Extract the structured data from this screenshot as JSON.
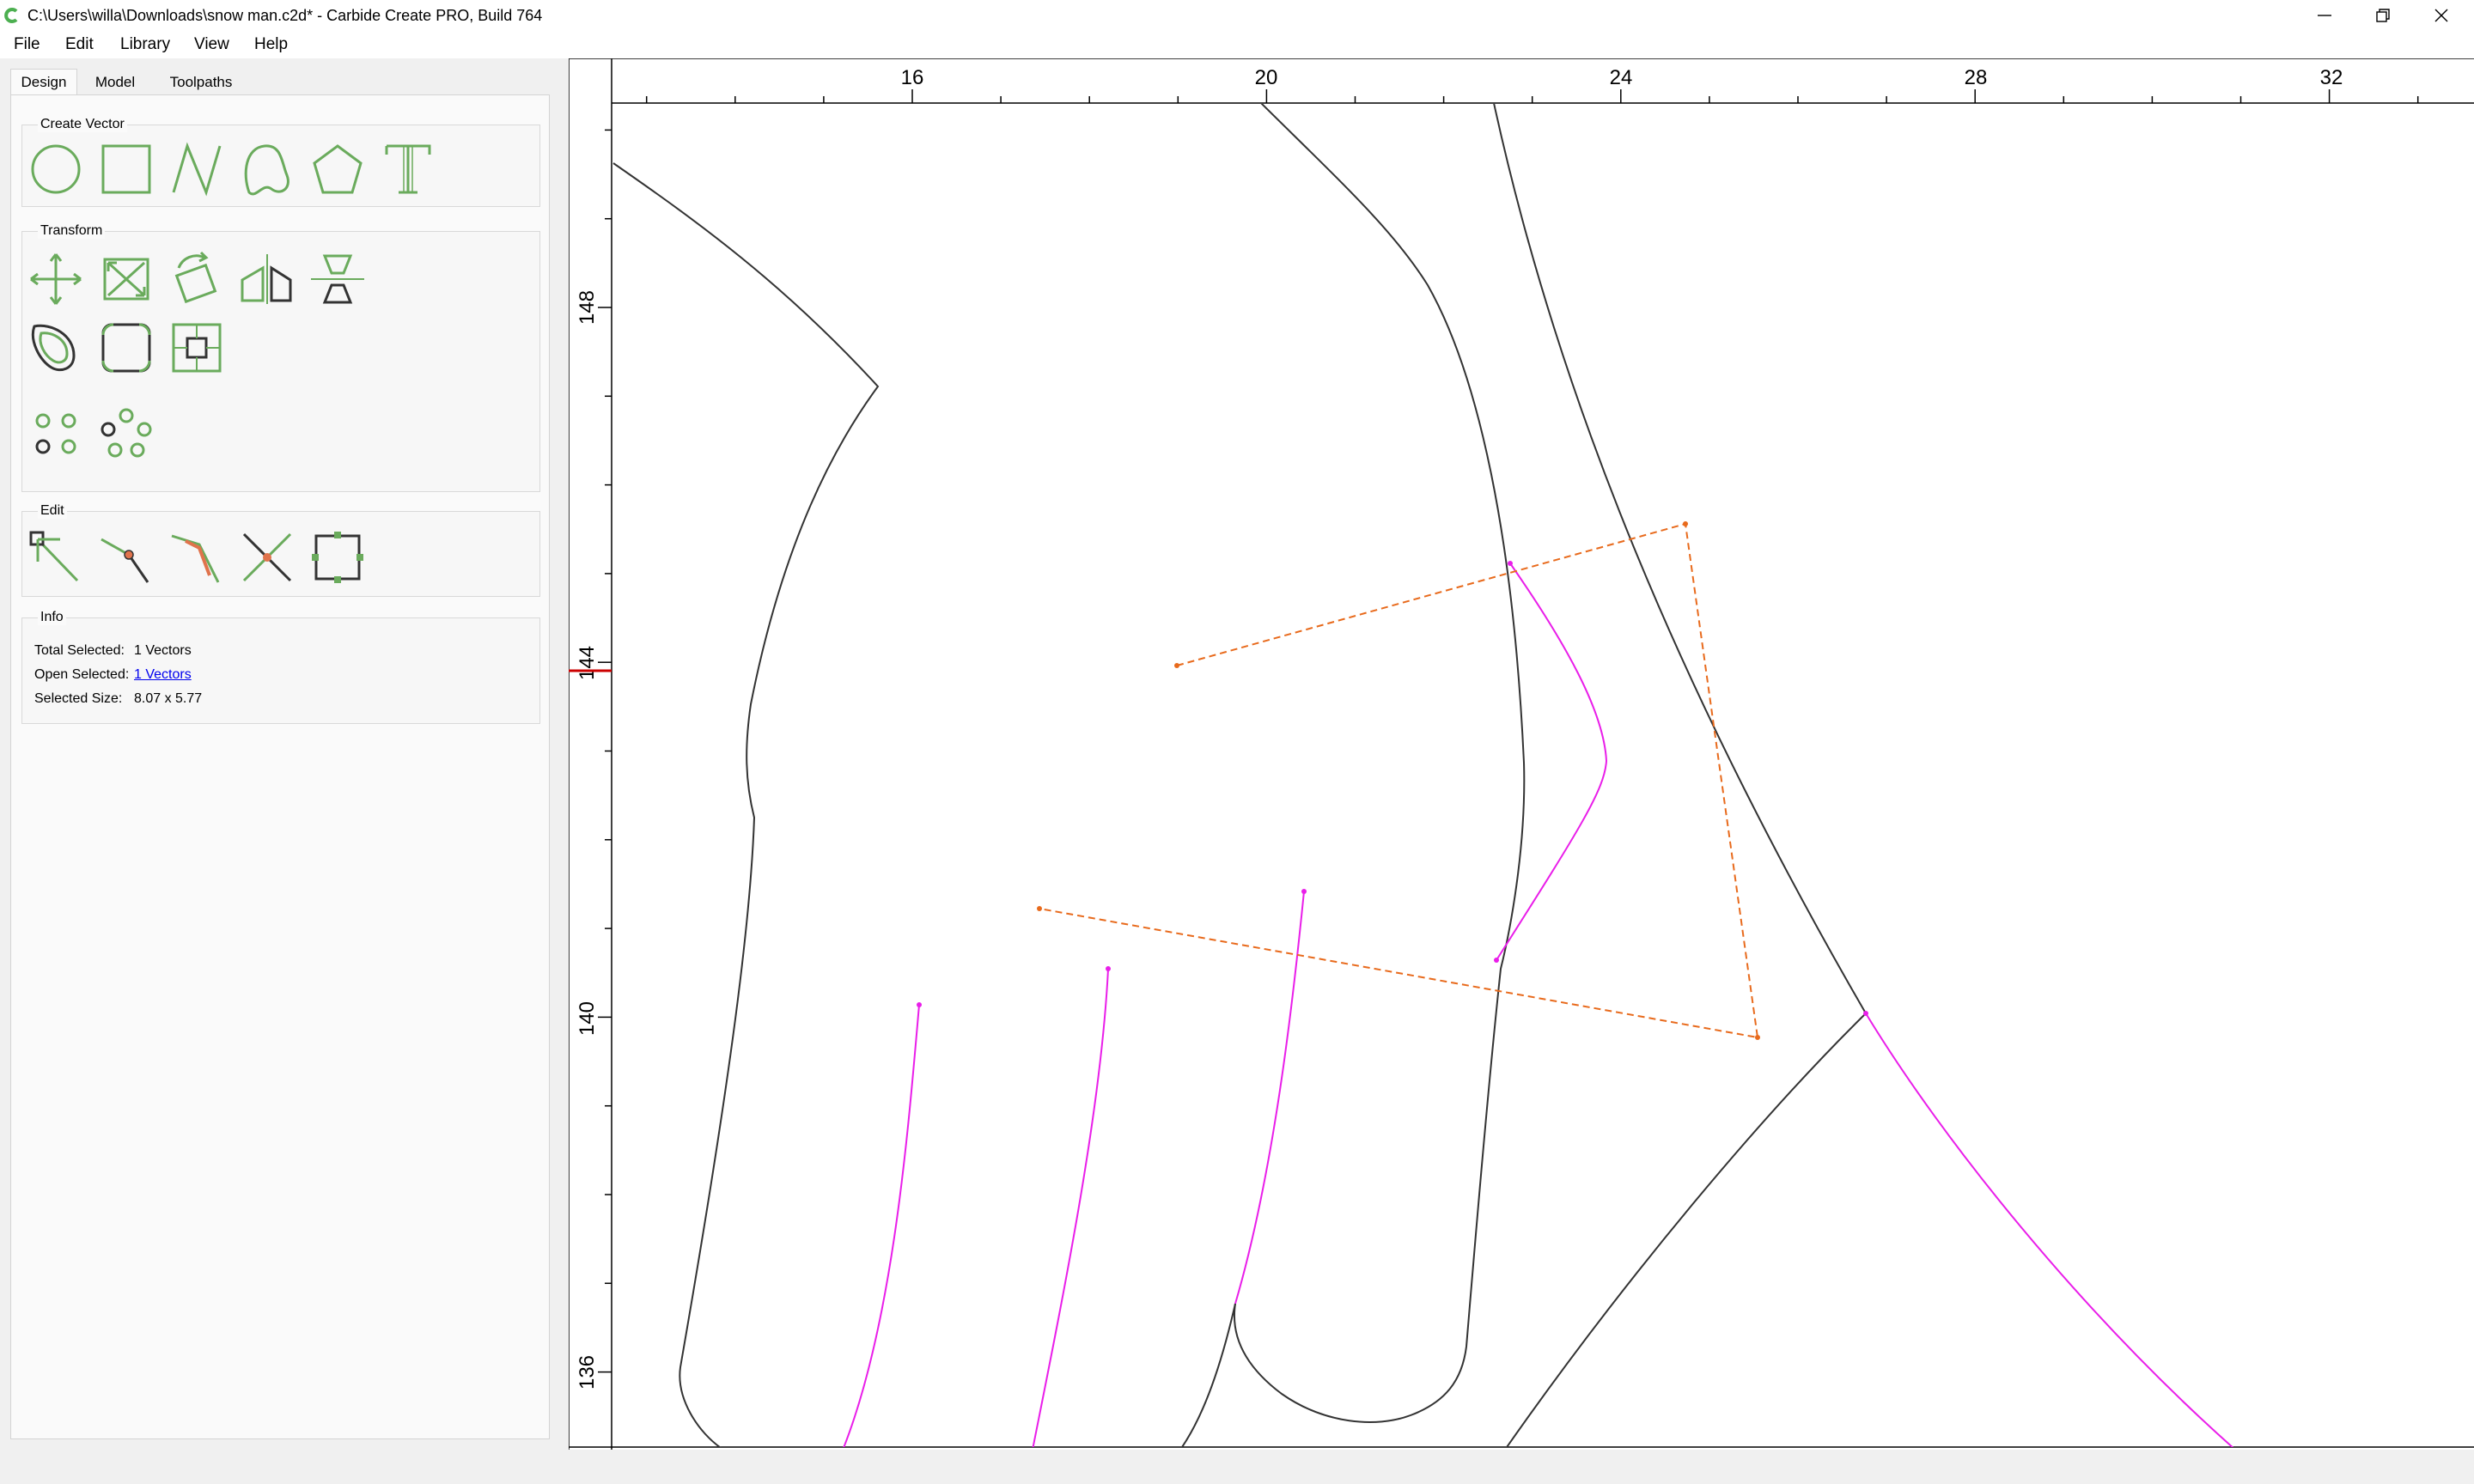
{
  "window": {
    "title": "C:\\Users\\willa\\Downloads\\snow man.c2d* - Carbide Create PRO, Build 764",
    "icon": "carbide-c-icon",
    "accent_color": "#4caf50"
  },
  "menu": {
    "file": "File",
    "edit": "Edit",
    "library": "Library",
    "view": "View",
    "help": "Help"
  },
  "tabs": {
    "design": "Design",
    "model": "Model",
    "toolpaths": "Toolpaths",
    "active": "Design"
  },
  "panel": {
    "create_vector": {
      "title": "Create Vector",
      "tools": [
        "circle-icon",
        "rectangle-icon",
        "polyline-icon",
        "curve-icon",
        "polygon-icon",
        "text-icon"
      ]
    },
    "transform": {
      "title": "Transform",
      "tools": [
        "move-icon",
        "scale-icon",
        "rotate-icon",
        "mirror-icon",
        "align-icon",
        "offset-icon",
        "fillet-icon",
        "bounding-box-icon",
        "grid-array-icon",
        "circular-array-icon"
      ]
    },
    "edit": {
      "title": "Edit",
      "tools": [
        "node-edit-icon",
        "split-icon",
        "trim-icon",
        "cut-icon",
        "bounding-box-edit-icon"
      ]
    },
    "info": {
      "title": "Info",
      "total_selected_label": "Total Selected:",
      "total_selected_value": "1 Vectors",
      "open_selected_label": "Open Selected:",
      "open_selected_value": "1 Vectors",
      "selected_size_label": "Selected Size:",
      "selected_size_value": "8.07 x 5.77"
    }
  },
  "canvas": {
    "ruler_x_labels": [
      "16",
      "20",
      "24",
      "28",
      "32"
    ],
    "ruler_y_labels": [
      "148",
      "144",
      "140",
      "136"
    ],
    "colors": {
      "vector": "#333333",
      "selected": "#e91ee9",
      "handles": "#e86a1c",
      "cursor_marker": "#cc0000"
    }
  }
}
